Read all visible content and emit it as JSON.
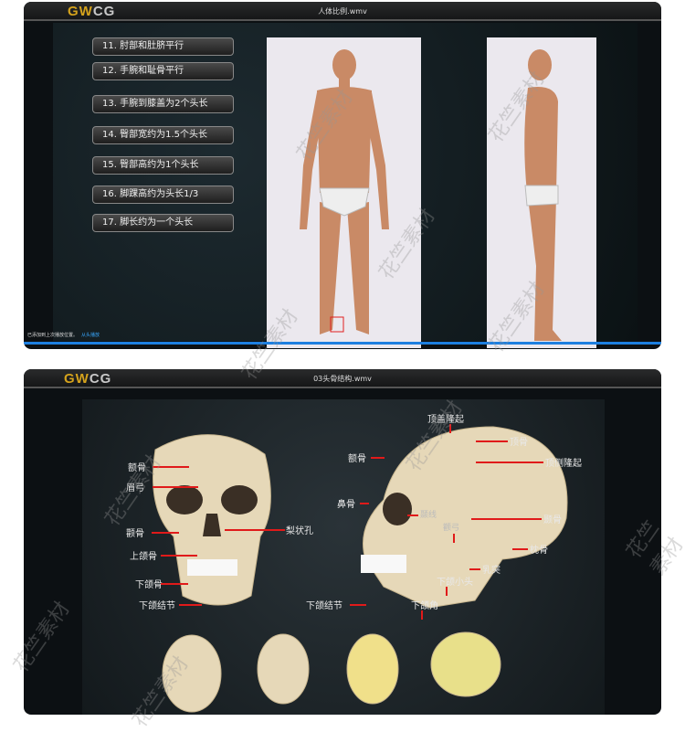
{
  "top_video": {
    "logo": {
      "gw": "GW",
      "cg": "CG"
    },
    "title": "人体比例.wmv",
    "proportion_buttons": [
      "11. 肘部和肚脐平行",
      "12. 手腕和耻骨平行",
      "13. 手腕到膝盖为2个头长",
      "14. 臀部宽约为1.5个头长",
      "15. 臀部高约为1个头长",
      "16. 脚踝高约为头长1/3",
      "17. 脚长约为一个头长"
    ],
    "status_text": "已添加到上次播放位置。",
    "status_link": "从头播放",
    "progress_percent": 100
  },
  "bottom_video": {
    "logo": {
      "gw": "GW",
      "cg": "CG"
    },
    "title": "03头骨结构.wmv",
    "front_labels": [
      "额骨",
      "眉弓",
      "颧骨",
      "上颌骨",
      "下颌骨",
      "下颌结节",
      "梨状孔"
    ],
    "side_labels": [
      "顶盖隆起",
      "顶骨",
      "顶侧隆起",
      "额骨",
      "鼻骨",
      "颞线",
      "颧弓",
      "颞骨",
      "枕骨",
      "乳突",
      "下颌小头",
      "下颌结节",
      "下颌角"
    ]
  },
  "watermark": "花竺素材"
}
